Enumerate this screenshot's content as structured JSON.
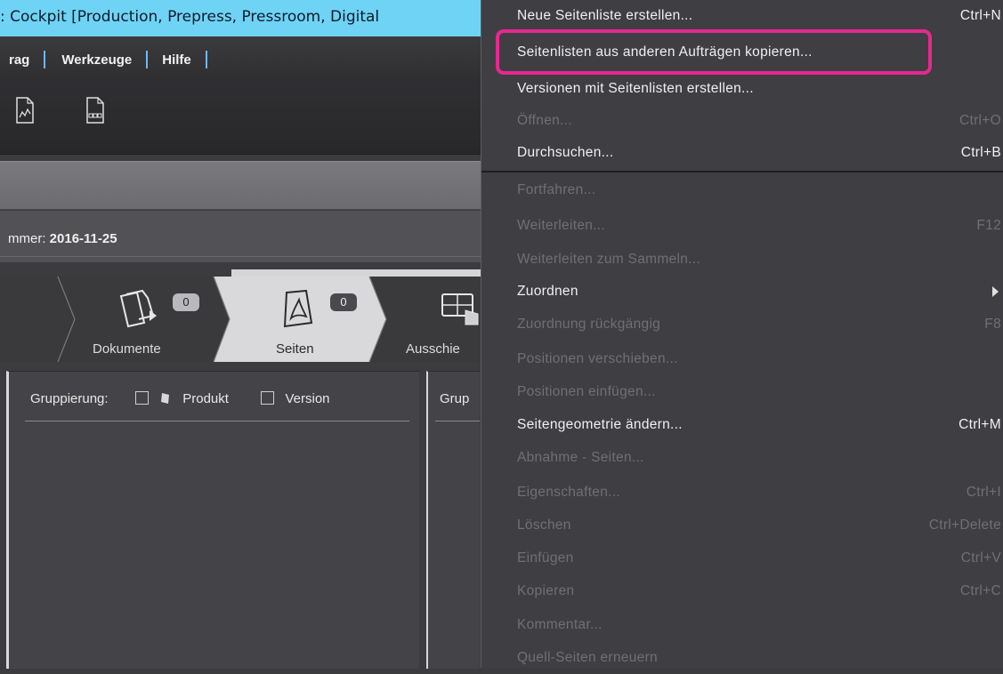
{
  "window": {
    "title": ": Cockpit [Production, Prepress, Pressroom, Digital"
  },
  "menubar": {
    "items": [
      "rag",
      "Werkzeuge",
      "Hilfe"
    ]
  },
  "toolbar": {
    "icons": [
      "pdf-approval-icon",
      "page-list-icon"
    ]
  },
  "info": {
    "label": "mmer: ",
    "value": "2016-11-25"
  },
  "steps": [
    {
      "label": "Dokumente",
      "count": "0",
      "icon": "documents-icon"
    },
    {
      "label": "Seiten",
      "count": "0",
      "icon": "pdf-pages-icon"
    },
    {
      "label": "Ausschie",
      "icon": "imposition-icon"
    }
  ],
  "panel_left": {
    "grouping_label": "Gruppierung:",
    "opt_product": "Produkt",
    "opt_version": "Version"
  },
  "panel_right": {
    "grouping_label": "Grup"
  },
  "menu": {
    "items": [
      {
        "label": "Neue Seitenliste erstellen...",
        "shortcut": "Ctrl+N",
        "enabled": true
      },
      {
        "label": "Seitenlisten aus anderen Aufträgen kopieren...",
        "shortcut": "",
        "enabled": true,
        "highlighted": true
      },
      {
        "label": "Versionen mit Seitenlisten erstellen...",
        "shortcut": "",
        "enabled": true
      },
      {
        "label": "Öffnen...",
        "shortcut": "Ctrl+O",
        "enabled": false
      },
      {
        "label": "Durchsuchen...",
        "shortcut": "Ctrl+B",
        "enabled": true
      },
      {
        "label": "Fortfahren...",
        "shortcut": "",
        "enabled": false
      },
      {
        "label": "Weiterleiten...",
        "shortcut": "F12",
        "enabled": false
      },
      {
        "label": "Weiterleiten zum Sammeln...",
        "shortcut": "",
        "enabled": false
      },
      {
        "label": "Zuordnen",
        "shortcut": "",
        "enabled": true,
        "submenu": true
      },
      {
        "label": "Zuordnung rückgängig",
        "shortcut": "F8",
        "enabled": false
      },
      {
        "label": "Positionen verschieben...",
        "shortcut": "",
        "enabled": false
      },
      {
        "label": "Positionen einfügen...",
        "shortcut": "",
        "enabled": false
      },
      {
        "label": "Seitengeometrie ändern...",
        "shortcut": "Ctrl+M",
        "enabled": true
      },
      {
        "label": "Abnahme - Seiten...",
        "shortcut": "",
        "enabled": false
      },
      {
        "label": "Eigenschaften...",
        "shortcut": "Ctrl+I",
        "enabled": false
      },
      {
        "label": "Löschen",
        "shortcut": "Ctrl+Delete",
        "enabled": false
      },
      {
        "label": "Einfügen",
        "shortcut": "Ctrl+V",
        "enabled": false
      },
      {
        "label": "Kopieren",
        "shortcut": "Ctrl+C",
        "enabled": false
      },
      {
        "label": "Kommentar...",
        "shortcut": "",
        "enabled": false
      },
      {
        "label": "Quell-Seiten erneuern",
        "shortcut": "",
        "enabled": false
      }
    ]
  },
  "colors": {
    "accent_highlight": "#e6288f",
    "titlebar": "#6fd3f5",
    "menu_bg": "#3f3f43"
  }
}
